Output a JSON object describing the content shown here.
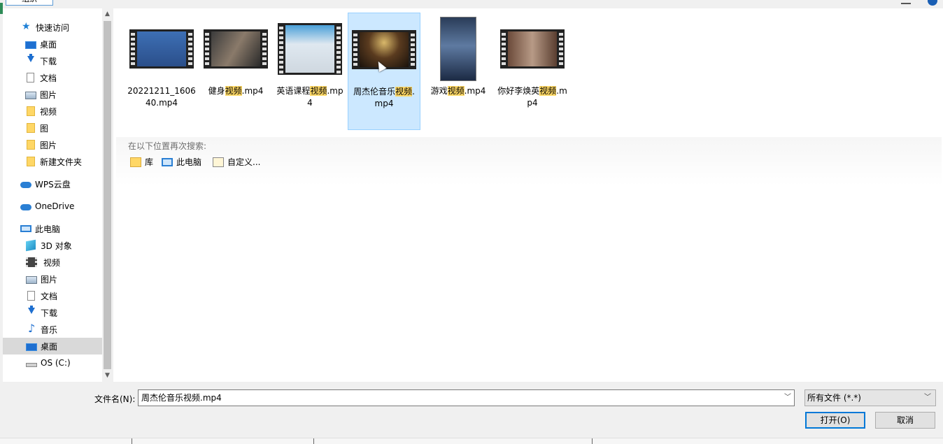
{
  "toolbar": {
    "organize_label": "组织"
  },
  "nav": {
    "items": [
      {
        "label": "快速访问",
        "icon": "star-icon"
      },
      {
        "label": "桌面",
        "icon": "desktop-icon",
        "pinned": true
      },
      {
        "label": "下载",
        "icon": "download-icon",
        "pinned": true
      },
      {
        "label": "文档",
        "icon": "document-icon",
        "pinned": true
      },
      {
        "label": "图片",
        "icon": "picture-icon",
        "pinned": true
      },
      {
        "label": "视频",
        "icon": "folder-icon"
      },
      {
        "label": "图",
        "icon": "folder-icon"
      },
      {
        "label": "图片",
        "icon": "folder-icon"
      },
      {
        "label": "新建文件夹",
        "icon": "folder-icon"
      },
      {
        "label": "WPS云盘",
        "icon": "cloud-icon"
      },
      {
        "label": "OneDrive",
        "icon": "onedrive-icon"
      },
      {
        "label": "此电脑",
        "icon": "computer-icon"
      },
      {
        "label": "3D 对象",
        "icon": "cube-icon"
      },
      {
        "label": "视频",
        "icon": "film-icon"
      },
      {
        "label": "图片",
        "icon": "picture-icon"
      },
      {
        "label": "文档",
        "icon": "document-icon"
      },
      {
        "label": "下载",
        "icon": "download-icon"
      },
      {
        "label": "音乐",
        "icon": "music-icon"
      },
      {
        "label": "桌面",
        "icon": "desktop-icon",
        "selected": true
      },
      {
        "label": "OS (C:)",
        "icon": "drive-icon"
      }
    ],
    "pin_glyph": "📌"
  },
  "files": [
    {
      "pre": "20221211_160640.mp4",
      "hl": "",
      "post": "",
      "selected": false
    },
    {
      "pre": "健身",
      "hl": "视频",
      "post": ".mp4",
      "selected": false
    },
    {
      "pre": "英语课程",
      "hl": "视频",
      "post": ".mp4",
      "selected": false
    },
    {
      "pre": "周杰伦音乐",
      "hl": "视频",
      "post": ".mp4",
      "selected": true
    },
    {
      "pre": "游戏",
      "hl": "视频",
      "post": ".mp4",
      "selected": false
    },
    {
      "pre": "你好李焕英",
      "hl": "视频",
      "post": ".mp4",
      "selected": false
    }
  ],
  "search_again": {
    "label": "在以下位置再次搜索:",
    "locations": [
      {
        "label": "库",
        "icon": "library-icon"
      },
      {
        "label": "此电脑",
        "icon": "computer-icon"
      },
      {
        "label": "自定义...",
        "icon": "custom-folder-icon"
      }
    ]
  },
  "footer": {
    "filename_label": "文件名(N):",
    "filename_value": "周杰伦音乐视频.mp4",
    "filetype_value": "所有文件 (*.*)",
    "open_label": "打开(O)",
    "cancel_label": "取消"
  },
  "colors": {
    "accent": "#0078d7",
    "selection": "#cce8ff",
    "highlight": "#ffd966"
  }
}
